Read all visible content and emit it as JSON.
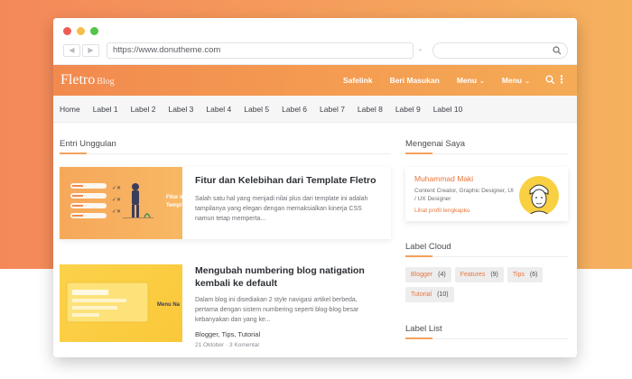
{
  "browser": {
    "url": "https://www.donutheme.com"
  },
  "site": {
    "logo": "Fletro",
    "logo_sub": "Blog",
    "menu": [
      {
        "label": "Safelink",
        "dropdown": false
      },
      {
        "label": "Beri Masukan",
        "dropdown": false
      },
      {
        "label": "Menu",
        "dropdown": true
      },
      {
        "label": "Menu",
        "dropdown": true
      }
    ]
  },
  "categories": [
    "Home",
    "Label 1",
    "Label 2",
    "Label 3",
    "Label 4",
    "Label 5",
    "Label 6",
    "Label 7",
    "Label 8",
    "Label 9",
    "Label 10"
  ],
  "main": {
    "section_title": "Entri Unggulan",
    "posts": [
      {
        "title": "Fitur dan Kelebihan dari Template Fletro",
        "excerpt": "Salah satu hal yang menjadi nilai plus dari template ini adalah tampilanya yang elegan dengan memaksialkan kinerja CSS namun tetap memperta...",
        "thumb_text": "Fitur d Templ"
      },
      {
        "title": "Mengubah numbering blog natigation kembali ke default",
        "excerpt": "Dalam blog ini disediakan 2 style navigasi artikel berbeda, pertama dengan sistem numbering seperti blog-blog besar kebanyakan dan yang ke...",
        "tags": "Blogger, Tips, Tutorial",
        "date": "21 Oktober",
        "comments": "3 Komentar",
        "thumb_text": "Menu Na"
      }
    ]
  },
  "sidebar": {
    "about_title": "Mengenai Saya",
    "profile": {
      "name": "Muhammad Maki",
      "desc": "Content Creator, Graphic Designer, UI / UX Designer",
      "link": "Lihat profil lengkapku"
    },
    "label_cloud_title": "Label Cloud",
    "labels": [
      {
        "name": "Blogger",
        "count": "(4)"
      },
      {
        "name": "Features",
        "count": "(9)"
      },
      {
        "name": "Tips",
        "count": "(6)"
      },
      {
        "name": "Tutorial",
        "count": "(10)"
      }
    ],
    "label_list_title": "Label List"
  },
  "colors": {
    "accent": "#f5a15c",
    "link": "#e8763c"
  }
}
